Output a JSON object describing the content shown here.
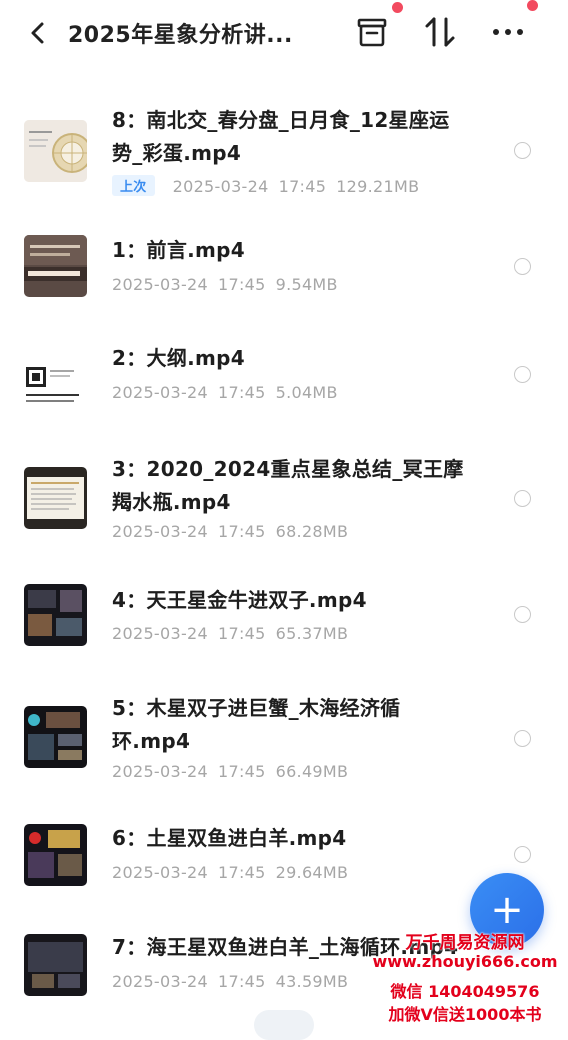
{
  "header": {
    "back_icon": "chevron-left-icon",
    "title": "2025年星象分析讲...",
    "actions": [
      "box-icon",
      "sort-icon",
      "more-icon"
    ],
    "notification_color": "#f24a5f"
  },
  "files": [
    {
      "name_line1": "8：南北交_春分盘_日月食_12星座运",
      "name_line2": "势_彩蛋.mp4",
      "badge": "上次",
      "date": "2025-03-24",
      "time": "17:45",
      "size": "129.21MB",
      "thumb_icon": "video-thumbnail-icon"
    },
    {
      "name_line1": "1：前言.mp4",
      "name_line2": "",
      "badge": "",
      "date": "2025-03-24",
      "time": "17:45",
      "size": "9.54MB",
      "thumb_icon": "video-thumbnail-icon"
    },
    {
      "name_line1": "2：大纲.mp4",
      "name_line2": "",
      "badge": "",
      "date": "2025-03-24",
      "time": "17:45",
      "size": "5.04MB",
      "thumb_icon": "video-thumbnail-icon"
    },
    {
      "name_line1": "3：2020_2024重点星象总结_冥王摩",
      "name_line2": "羯水瓶.mp4",
      "badge": "",
      "date": "2025-03-24",
      "time": "17:45",
      "size": "68.28MB",
      "thumb_icon": "video-thumbnail-icon"
    },
    {
      "name_line1": "4：天王星金牛进双子.mp4",
      "name_line2": "",
      "badge": "",
      "date": "2025-03-24",
      "time": "17:45",
      "size": "65.37MB",
      "thumb_icon": "video-thumbnail-icon"
    },
    {
      "name_line1": "5：木星双子进巨蟹_木海经济循",
      "name_line2": "环.mp4",
      "badge": "",
      "date": "2025-03-24",
      "time": "17:45",
      "size": "66.49MB",
      "thumb_icon": "video-thumbnail-icon"
    },
    {
      "name_line1": "6：土星双鱼进白羊.mp4",
      "name_line2": "",
      "badge": "",
      "date": "2025-03-24",
      "time": "17:45",
      "size": "29.64MB",
      "thumb_icon": "video-thumbnail-icon"
    },
    {
      "name_line1": "7：海王星双鱼进白羊_土海循环.mp4",
      "name_line2": "",
      "badge": "",
      "date": "2025-03-24",
      "time": "17:45",
      "size": "43.59MB",
      "thumb_icon": "video-thumbnail-icon"
    }
  ],
  "fab": {
    "label": "+",
    "icon": "plus-icon",
    "color": "#2b6fe8"
  },
  "watermark": {
    "line1": "万千周易资源网",
    "line2": "www.zhouyi666.com",
    "line3": "微信 1404049576",
    "line4": "加微V信送1000本书"
  }
}
